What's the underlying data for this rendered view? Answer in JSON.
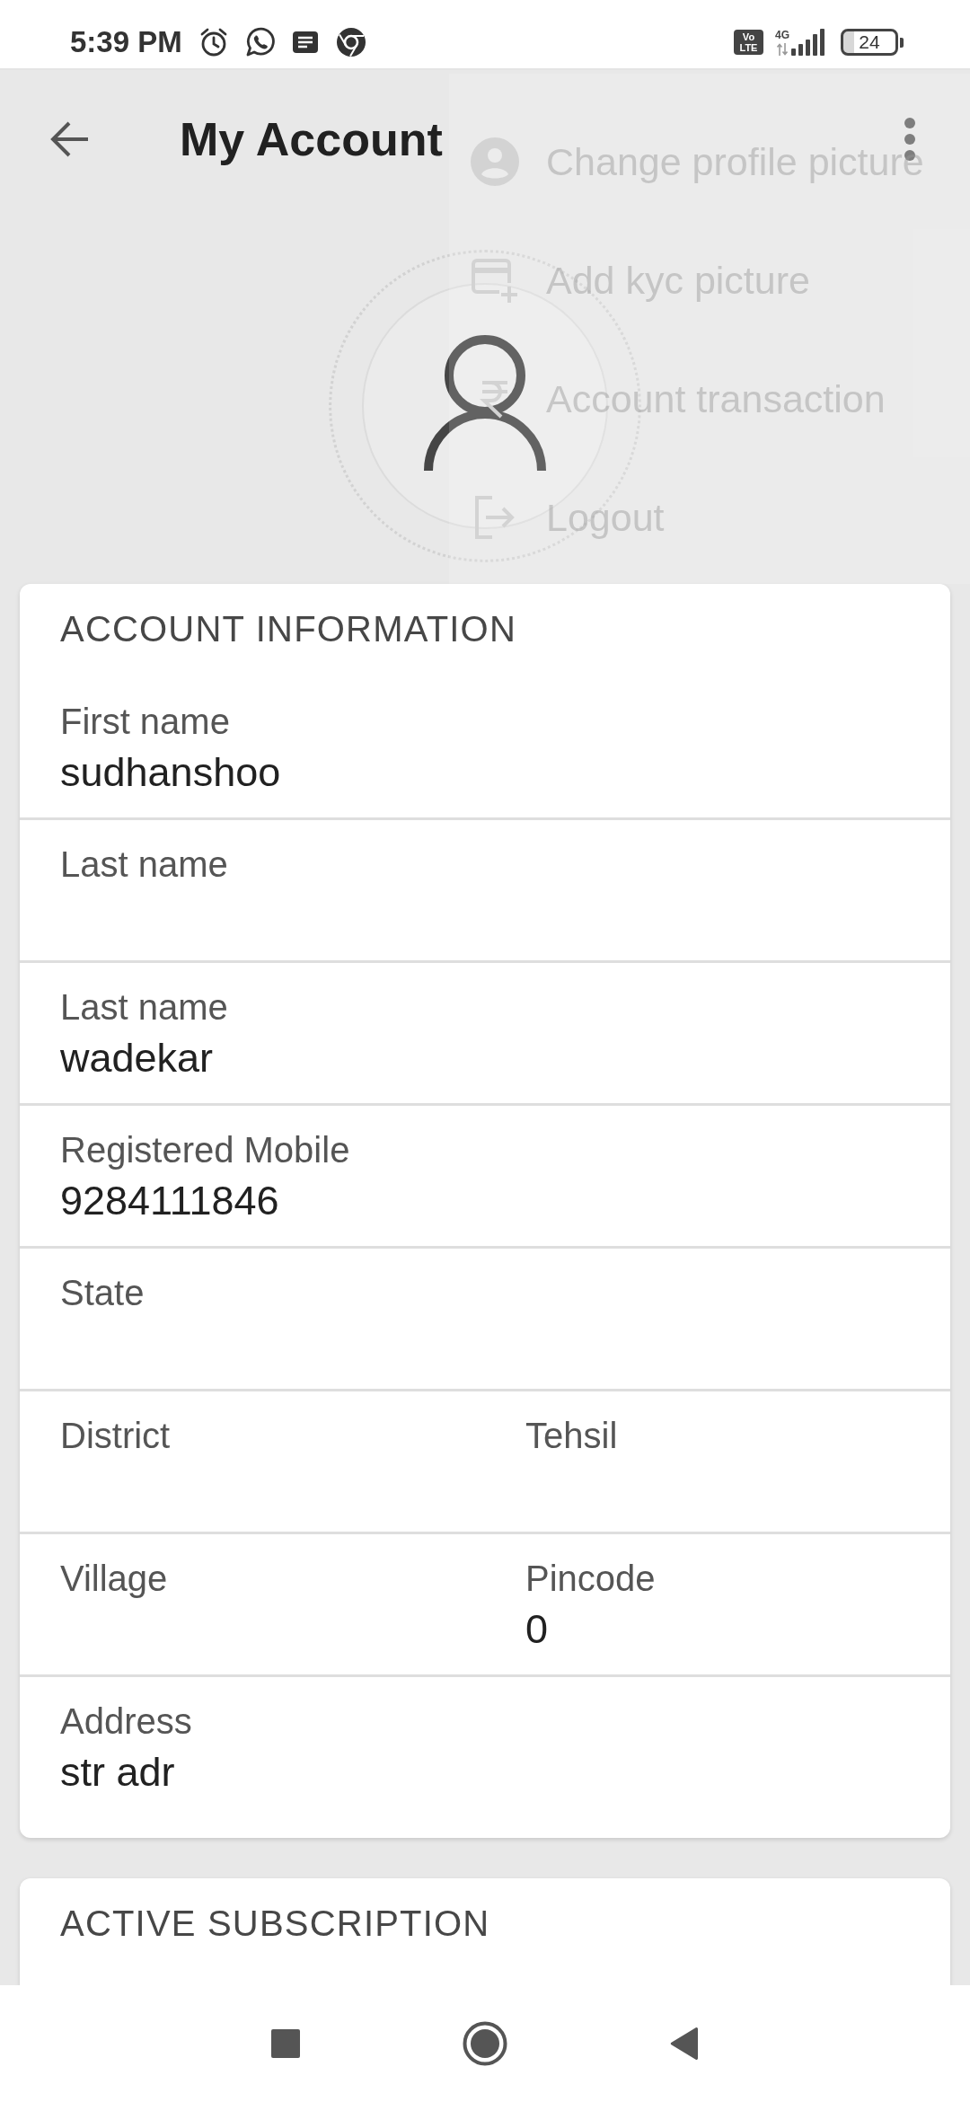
{
  "status_bar": {
    "time": "5:39 PM",
    "volte": "Vo LTE",
    "network": "4G",
    "battery": "24"
  },
  "app_bar": {
    "title": "My Account"
  },
  "menu": {
    "items": [
      {
        "kind": "profile",
        "label": "Change profile picture"
      },
      {
        "kind": "kyc",
        "label": "Add kyc picture"
      },
      {
        "kind": "transaction",
        "label": "Account transaction"
      },
      {
        "kind": "logout",
        "label": "Logout"
      }
    ]
  },
  "sections": [
    {
      "title": "ACCOUNT INFORMATION",
      "rows": [
        {
          "fields": [
            {
              "label": "First name",
              "value": "sudhanshoo"
            }
          ]
        },
        {
          "fields": [
            {
              "label": "Last name"
            }
          ]
        },
        {
          "fields": [
            {
              "label": "Last name",
              "value": "wadekar"
            }
          ]
        },
        {
          "fields": [
            {
              "label": "Registered Mobile",
              "value": "9284111846"
            }
          ]
        },
        {
          "fields": [
            {
              "label": "State"
            }
          ]
        },
        {
          "fields": [
            {
              "label": "District"
            },
            {
              "label": "Tehsil"
            }
          ]
        },
        {
          "fields": [
            {
              "label": "Village"
            },
            {
              "label": "Pincode",
              "value": "0"
            }
          ]
        },
        {
          "fields": [
            {
              "label": "Address",
              "value": "str adr"
            }
          ]
        }
      ]
    },
    {
      "title": "ACTIVE SUBSCRIPTION"
    }
  ]
}
